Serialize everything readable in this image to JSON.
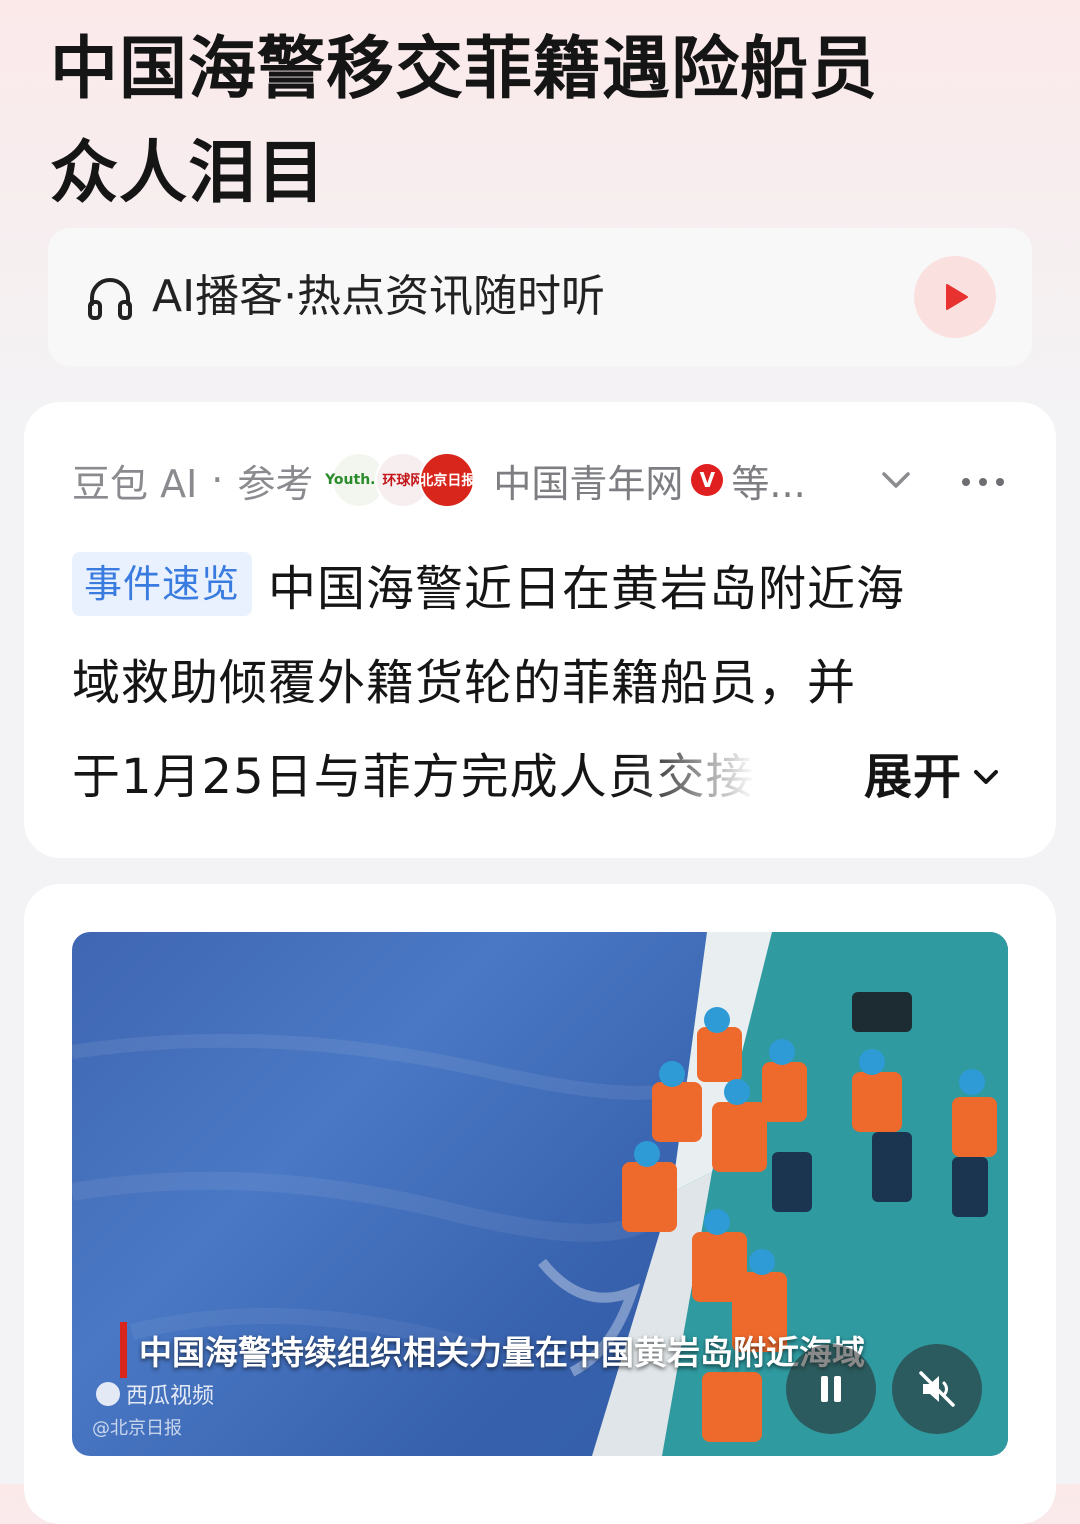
{
  "article": {
    "title_line1": "中国海警移交菲籍遇险船员",
    "title_line2": "众人泪目"
  },
  "podcast": {
    "label": "AI播客·热点资讯随时听",
    "icon": "headphones-icon",
    "play_icon": "play-icon"
  },
  "summary_card": {
    "author": "豆包 AI",
    "separator": "·",
    "reference_label": "参考",
    "source_logos": [
      {
        "name": "中国青年网 Youth.cn",
        "text": "Youth.cn"
      },
      {
        "name": "环球网",
        "text": "环球网"
      },
      {
        "name": "北京日报",
        "text": "北京日报"
      }
    ],
    "source_name": "中国青年网",
    "verified_badge": "V",
    "more_sources": "等...",
    "tag": "事件速览",
    "line1": "中国海警近日在黄岩岛附近海",
    "line2": "域救助倾覆外籍货轮的菲籍船员，并",
    "line3": "于1月25日与菲方完成人员交接",
    "expand_label": "展开"
  },
  "video": {
    "caption": "中国海警持续组织相关力量在中国黄岩岛附近海域",
    "watermark_platform": "西瓜视频",
    "watermark_source": "@北京日报",
    "pause_icon": "pause-icon",
    "mute_icon": "mute-icon"
  },
  "colors": {
    "accent_red": "#e02020",
    "tag_blue": "#3a7be0",
    "tag_bg": "#e8f1fd"
  }
}
